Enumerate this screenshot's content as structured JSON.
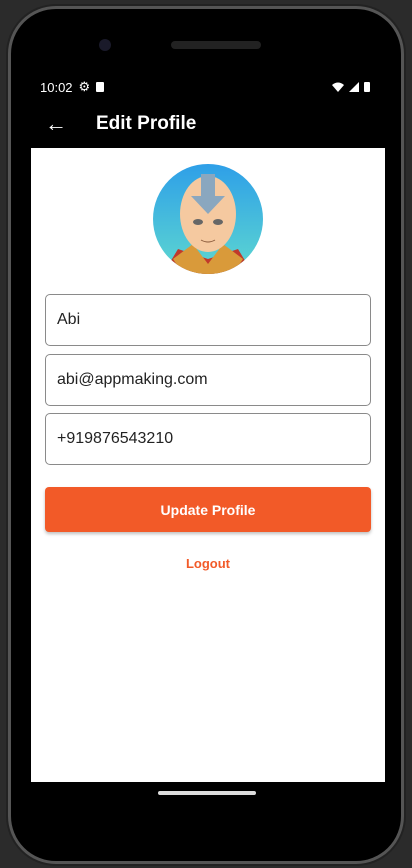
{
  "status": {
    "time": "10:02",
    "icons": [
      "settings-icon",
      "sd-card-icon",
      "wifi-icon",
      "signal-icon",
      "battery-icon"
    ]
  },
  "appbar": {
    "title": "Edit Profile",
    "back_icon": "arrow-back-icon"
  },
  "form": {
    "name": "Abi",
    "email": "abi@appmaking.com",
    "phone": "+919876543210"
  },
  "buttons": {
    "update": "Update Profile",
    "logout": "Logout"
  },
  "colors": {
    "accent": "#f25a28"
  }
}
